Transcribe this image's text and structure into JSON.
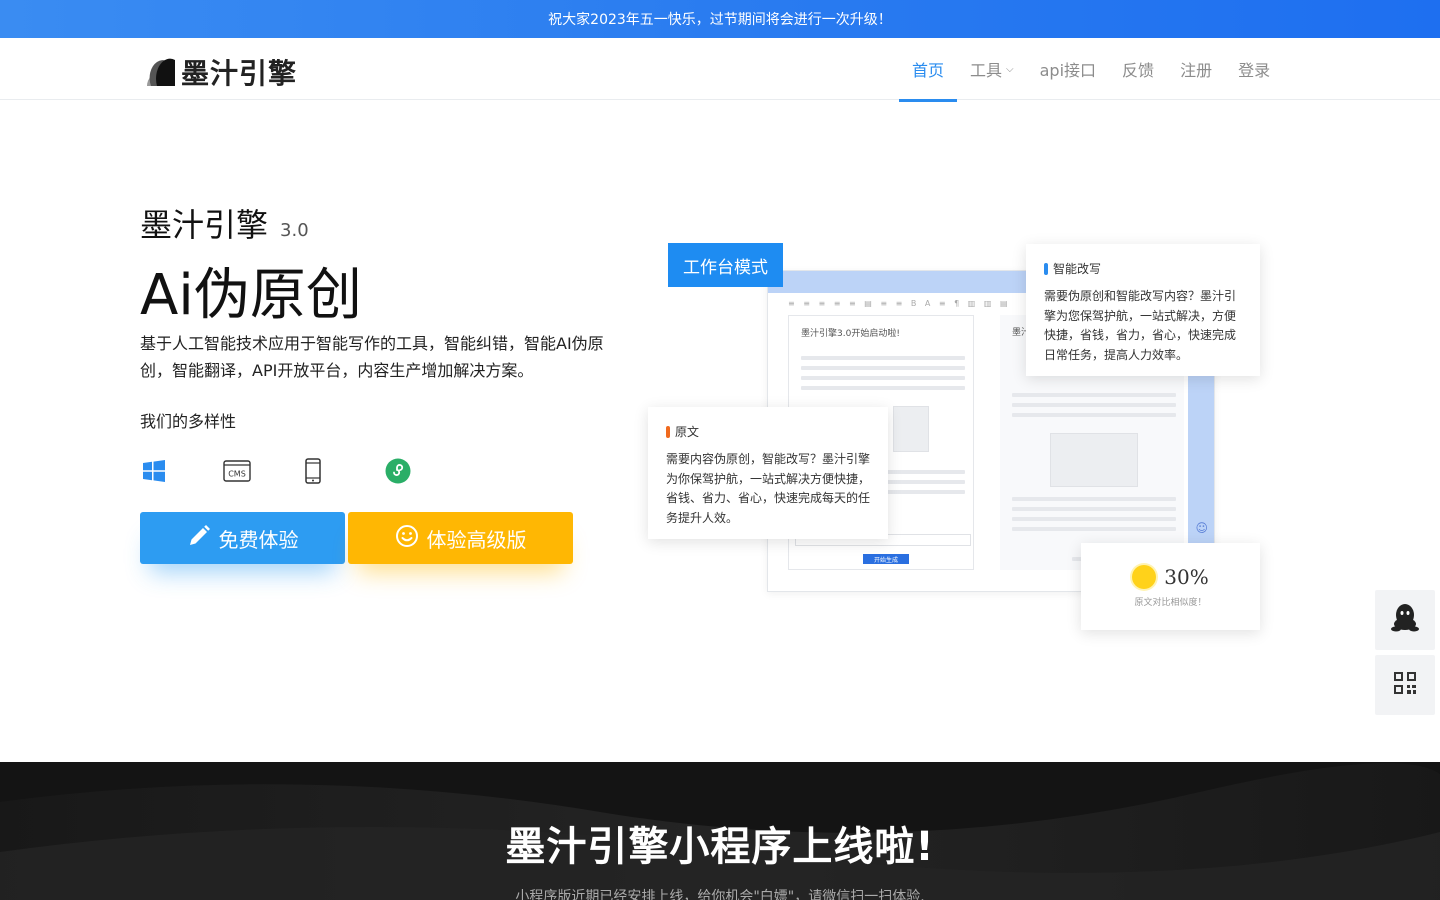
{
  "banner": {
    "text": "祝大家2023年五一快乐，过节期间将会进行一次升级！"
  },
  "header": {
    "logo_text": "墨汁引擎",
    "nav": [
      {
        "label": "首页",
        "active": true
      },
      {
        "label": "工具",
        "has_dropdown": true
      },
      {
        "label": "api接口"
      },
      {
        "label": "反馈"
      },
      {
        "label": "注册"
      },
      {
        "label": "登录"
      }
    ]
  },
  "hero": {
    "brand": "墨汁引擎",
    "version": "3.0",
    "title": "Ai伪原创",
    "description": "基于人工智能技术应用于智能写作的工具，智能纠错，智能AI伪原创，智能翻译，API开放平台，内容生产增加解决方案。",
    "diversity_label": "我们的多样性",
    "platform_icons": [
      "windows-icon",
      "cms-icon",
      "mobile-icon",
      "mini-program-icon"
    ],
    "buttons": {
      "free_label": "免费体验",
      "pro_label": "体验高级版"
    },
    "colors": {
      "accent": "#2a8cef",
      "free_button": "#2d9cf2",
      "pro_button": "#ffb703"
    }
  },
  "illustration": {
    "mode_tag": "工作台模式",
    "doc_title": "墨汁引擎3.0开始启动啦!",
    "doc2_title": "墨汁",
    "generate_label": "开始生成",
    "card_rewrite": {
      "title": "智能改写",
      "text": "需要伪原创和智能改写内容？墨汁引擎为您保驾护航，一站式解决，方便快捷，省钱，省力，省心，快速完成日常任务，提高人力效率。"
    },
    "card_original": {
      "title": "原文",
      "text": "需要内容伪原创，智能改写？墨汁引擎为你保驾护航，一站式解决方便快捷，省钱、省力、省心，快速完成每天的任务提升人效。"
    },
    "similarity": {
      "value": "30%",
      "caption": "原文对比相似度！"
    }
  },
  "floating": [
    "qq-icon",
    "qrcode-icon"
  ],
  "promo": {
    "title": "墨汁引擎小程序上线啦!",
    "subtitle": "小程序版近期已经安排上线，给你机会\"白嫖\"，请微信扫一扫体验."
  }
}
